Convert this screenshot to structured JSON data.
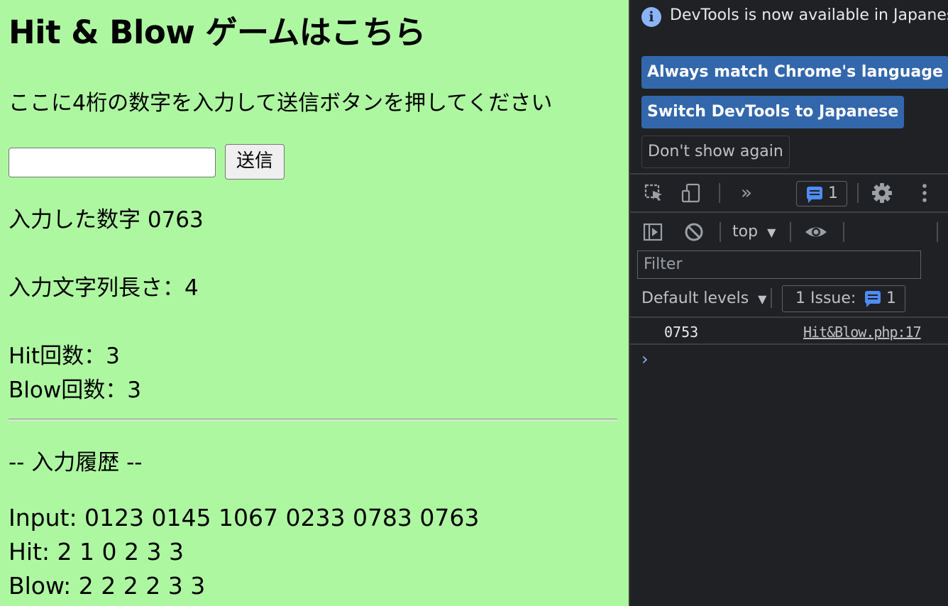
{
  "page": {
    "title": "Hit & Blow ゲームはこちら",
    "instruction": "ここに4桁の数字を入力して送信ボタンを押してください",
    "input_value": "",
    "submit_label": "送信",
    "input_number_text": "入力した数字 0763",
    "length_text": "入力文字列長さ：4",
    "hit_text": "Hit回数：3",
    "blow_text": "Blow回数：3",
    "history_heading": "-- 入力履歴 --",
    "history_input": "Input: 0123 0145 1067 0233 0783 0763",
    "history_hit": "Hit: 2 1 0 2 3 3",
    "history_blow": "Blow: 2 2 2 2 3 3",
    "background_color": "#aef7a1"
  },
  "devtools": {
    "banner": {
      "message": "DevTools is now available in Japanese!",
      "info_icon": "i",
      "always_match_label": "Always match Chrome's language",
      "switch_label": "Switch DevTools to Japanese",
      "dont_show_label": "Don't show again"
    },
    "toolbar": {
      "more_tabs_icon": "»",
      "message_count": "1"
    },
    "console_toolbar": {
      "context": "top",
      "filter_placeholder": "Filter",
      "levels_label": "Default levels",
      "issues_label": "1 Issue:",
      "issues_count": "1"
    },
    "log": {
      "value": "0753",
      "source": "Hit&Blow.php:17",
      "prompt_symbol": "›"
    },
    "accent_color": "#3367ac"
  }
}
